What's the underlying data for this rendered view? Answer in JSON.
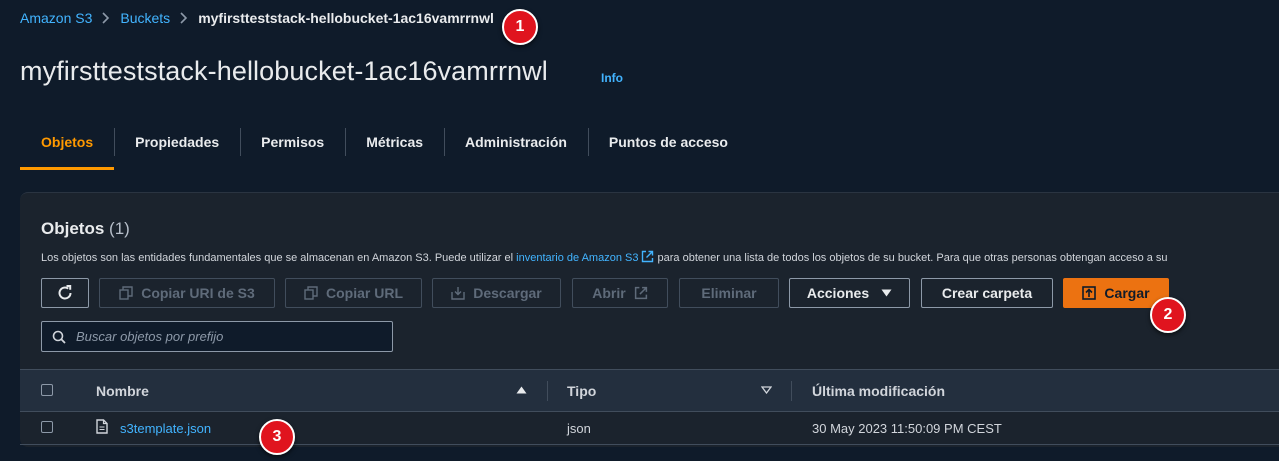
{
  "breadcrumb": {
    "items": [
      "Amazon S3",
      "Buckets"
    ],
    "current": "myfirstteststack-hellobucket-1ac16vamrrnwl"
  },
  "page": {
    "title": "myfirstteststack-hellobucket-1ac16vamrrnwl",
    "info_label": "Info"
  },
  "tabs": [
    {
      "label": "Objetos",
      "active": true
    },
    {
      "label": "Propiedades"
    },
    {
      "label": "Permisos"
    },
    {
      "label": "Métricas"
    },
    {
      "label": "Administración"
    },
    {
      "label": "Puntos de acceso"
    }
  ],
  "objects_panel": {
    "title": "Objetos",
    "count": "(1)",
    "description_before": "Los objetos son las entidades fundamentales que se almacenan en Amazon S3. Puede utilizar el ",
    "description_link": "inventario de Amazon S3",
    "description_after": " para obtener una lista de todos los objetos de su bucket. Para que otras personas obtengan acceso a su"
  },
  "toolbar": {
    "copy_uri": "Copiar URI de S3",
    "copy_url": "Copiar URL",
    "download": "Descargar",
    "open": "Abrir",
    "delete": "Eliminar",
    "actions": "Acciones",
    "create_folder": "Crear carpeta",
    "upload": "Cargar"
  },
  "search": {
    "placeholder": "Buscar objetos por prefijo"
  },
  "table": {
    "columns": [
      "Nombre",
      "Tipo",
      "Última modificación"
    ],
    "rows": [
      {
        "name": "s3template.json",
        "type": "json",
        "modified": "30 May 2023 11:50:09 PM CEST"
      }
    ]
  },
  "annotations": [
    "1",
    "2",
    "3"
  ],
  "colors": {
    "background": "#0f1b2a",
    "accent": "#ff9900",
    "primary_button": "#ec7211",
    "link": "#42b4ff",
    "badge": "#e0141e"
  }
}
